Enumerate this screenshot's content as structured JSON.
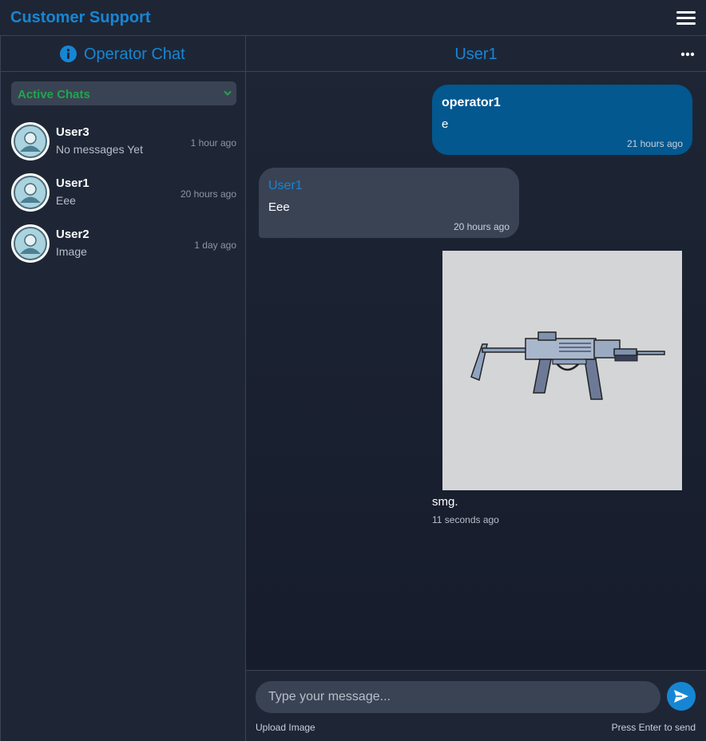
{
  "app": {
    "title": "Customer Support"
  },
  "sidebar": {
    "title": "Operator Chat",
    "filter": {
      "selected": "Active Chats"
    },
    "chats": [
      {
        "name": "User3",
        "preview": "No messages Yet",
        "time": "1 hour ago"
      },
      {
        "name": "User1",
        "preview": "Eee",
        "time": "20 hours ago"
      },
      {
        "name": "User2",
        "preview": "Image",
        "time": "1 day ago"
      }
    ]
  },
  "conversation": {
    "title": "User1",
    "messages": [
      {
        "sender": "operator1",
        "text": "e",
        "time": "21 hours ago",
        "direction": "outgoing"
      },
      {
        "sender": "User1",
        "text": "Eee",
        "time": "20 hours ago",
        "direction": "incoming"
      }
    ],
    "image_message": {
      "caption": "smg.",
      "time": "11 seconds ago",
      "image": "smg-pixel-art"
    }
  },
  "composer": {
    "placeholder": "Type your message...",
    "upload_label": "Upload Image",
    "hint": "Press Enter to send"
  },
  "colors": {
    "accent": "#1686d4",
    "active_filter": "#1fa64a",
    "outgoing_bubble": "#02588f",
    "incoming_bubble": "#3a4354",
    "background": "#1e2636"
  },
  "icons": [
    "menu-icon",
    "info-icon",
    "chevron-down-icon",
    "avatar-icon",
    "more-options-icon",
    "send-icon"
  ]
}
